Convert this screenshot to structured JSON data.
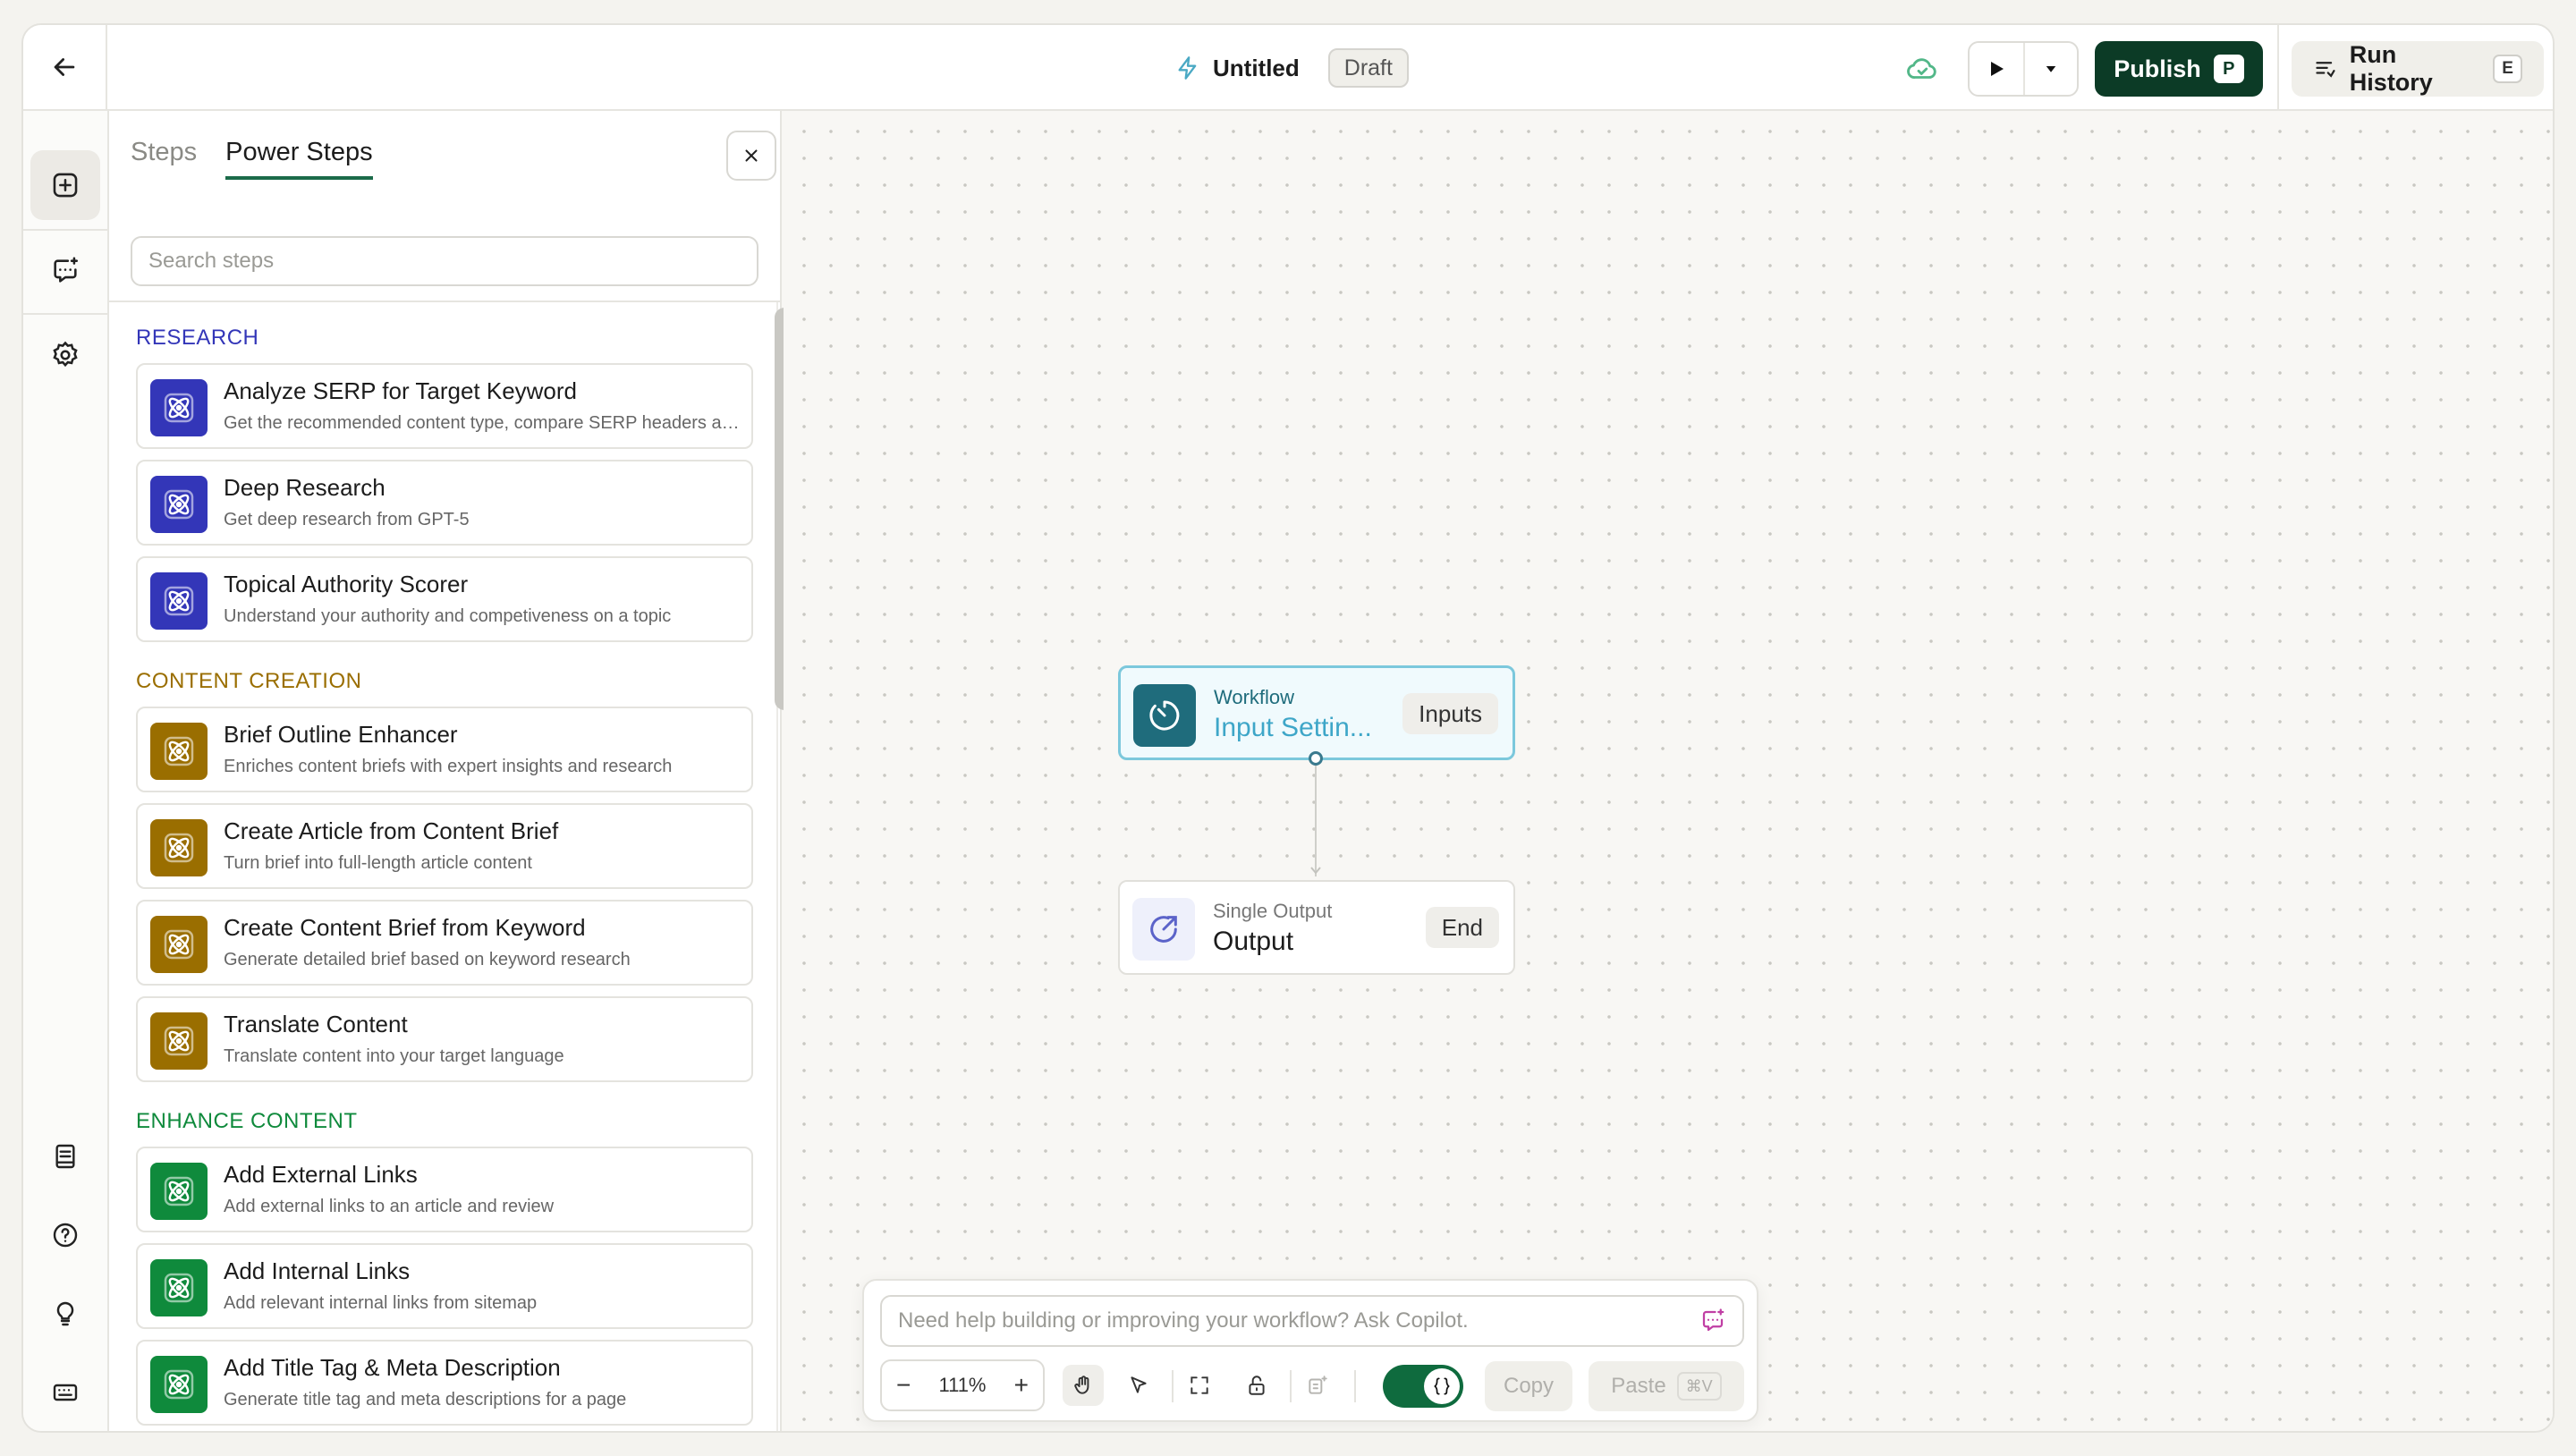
{
  "header": {
    "title": "Untitled",
    "status": "Draft",
    "publish_label": "Publish",
    "publish_shortcut": "P",
    "run_history_label": "Run History",
    "run_history_shortcut": "E"
  },
  "panel": {
    "tabs": [
      {
        "label": "Steps",
        "active": false
      },
      {
        "label": "Power Steps",
        "active": true
      }
    ],
    "search_placeholder": "Search steps",
    "sections": [
      {
        "title": "RESEARCH",
        "color": "#3336b8",
        "items": [
          {
            "name": "Analyze SERP for Target Keyword",
            "desc": "Get the recommended content type, compare SERP headers and more"
          },
          {
            "name": "Deep Research",
            "desc": "Get deep research from GPT-5"
          },
          {
            "name": "Topical Authority Scorer",
            "desc": "Understand your authority and competiveness on a topic"
          }
        ]
      },
      {
        "title": "CONTENT CREATION",
        "color": "#9a6e00",
        "items": [
          {
            "name": "Brief Outline Enhancer",
            "desc": "Enriches content briefs with expert insights and research"
          },
          {
            "name": "Create Article from Content Brief",
            "desc": "Turn brief into full-length article content"
          },
          {
            "name": "Create Content Brief from Keyword",
            "desc": "Generate detailed brief based on keyword research"
          },
          {
            "name": "Translate Content",
            "desc": "Translate content into your target language"
          }
        ]
      },
      {
        "title": "ENHANCE CONTENT",
        "color": "#0f8a3c",
        "items": [
          {
            "name": "Add External Links",
            "desc": "Add external links to an article and review"
          },
          {
            "name": "Add Internal Links",
            "desc": "Add relevant internal links from sitemap"
          },
          {
            "name": "Add Title Tag & Meta Description",
            "desc": "Generate title tag and meta descriptions for a page"
          }
        ]
      }
    ]
  },
  "canvas": {
    "nodes": [
      {
        "type": "Workflow",
        "title": "Input Settin...",
        "pill": "Inputs"
      },
      {
        "type": "Single Output",
        "title": "Output",
        "pill": "End"
      }
    ]
  },
  "copilot": {
    "placeholder": "Need help building or improving your workflow? Ask Copilot.",
    "zoom": "111%",
    "copy_label": "Copy",
    "paste_label": "Paste",
    "paste_shortcut": "⌘V"
  },
  "colors": {
    "publish_bg": "#0c3b26",
    "research": "#3336b8",
    "content_creation": "#9a6e00",
    "enhance_content": "#0f8a3c",
    "workflow_node": "#1f6c7c"
  }
}
